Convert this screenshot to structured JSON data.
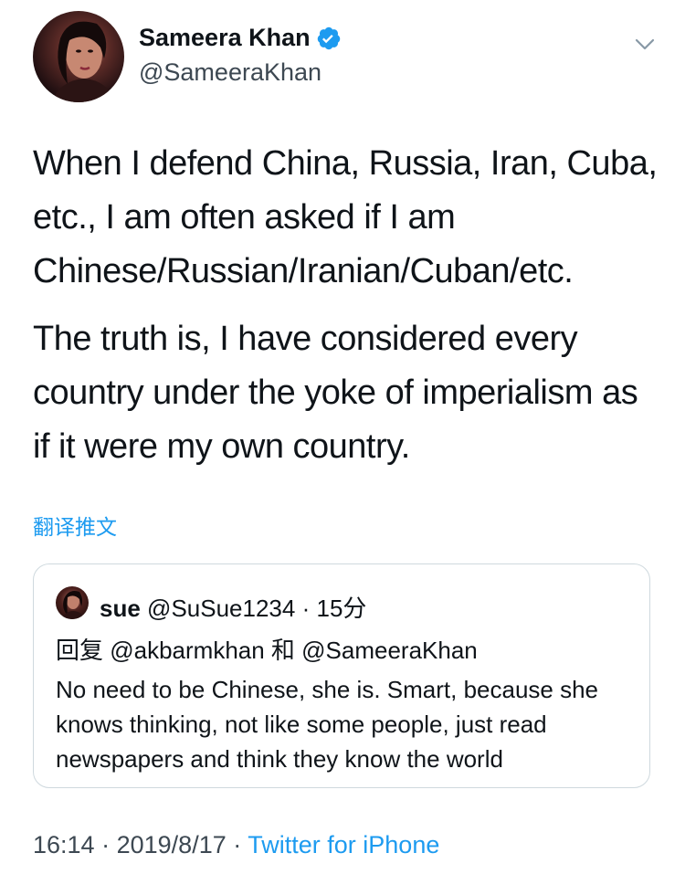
{
  "author": {
    "name": "Sameera Khan",
    "handle": "@SameeraKhan",
    "verified_icon": "verified-badge-icon",
    "menu_icon": "chevron-down-icon"
  },
  "tweet": {
    "paragraphs": [
      "When I defend China, Russia, Iran, Cuba, etc., I am often asked if I am Chinese/Russian/Iranian/Cuban/etc.",
      "The truth is, I have considered every country under the yoke of imperialism as if it were my own country."
    ],
    "translate_label": "翻译推文"
  },
  "quote": {
    "name": "sue",
    "handle": "@SuSue1234",
    "separator": "·",
    "time": "15分",
    "reply_to": "回复 @akbarmkhan 和 @SameeraKhan",
    "text": "No need to be Chinese, she is. Smart, because she knows thinking, not like some people, just read newspapers and think they know the world"
  },
  "footer": {
    "time": "16:14",
    "sep1": "·",
    "date": "2019/8/17",
    "sep2": "·",
    "source": "Twitter for iPhone"
  },
  "colors": {
    "accent": "#1d9bf0",
    "text": "#0f1419",
    "secondary": "#3d4852",
    "border": "#cfd9de"
  }
}
